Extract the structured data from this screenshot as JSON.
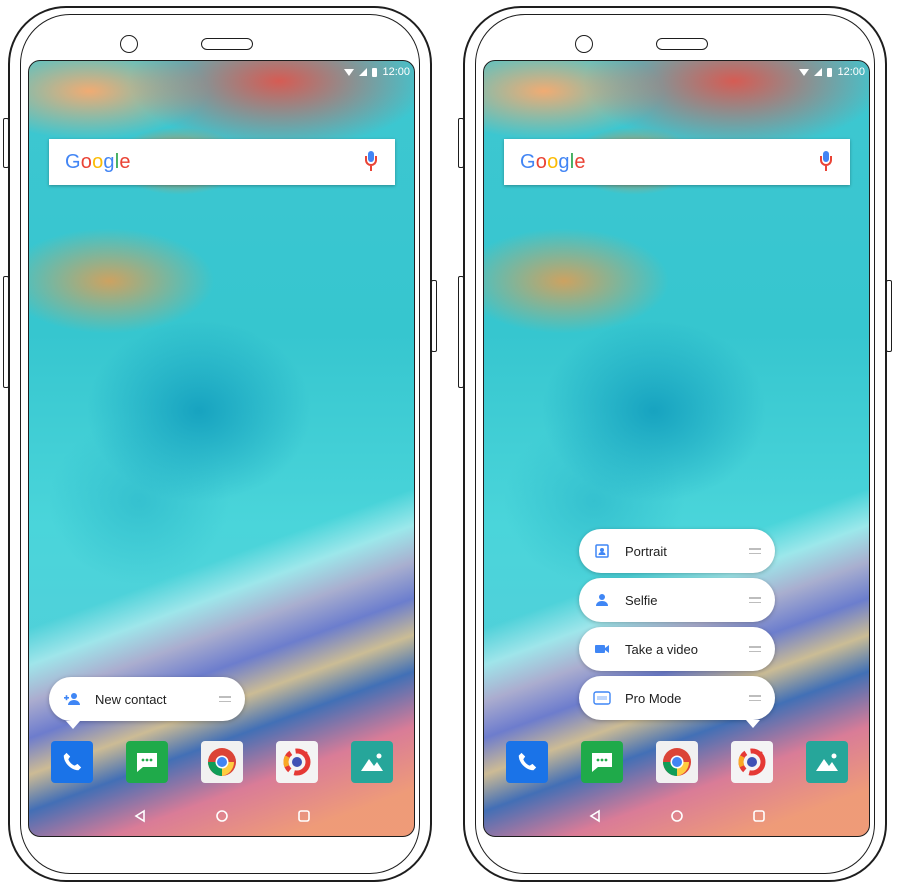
{
  "left_screen": {
    "status_bar": {
      "time": "12:00"
    },
    "search": {
      "logo": [
        "G",
        "o",
        "o",
        "g",
        "l",
        "e"
      ],
      "mic_icon": "mic-icon"
    },
    "shortcut_menu": {
      "items": [
        {
          "label": "New contact",
          "icon": "add-contact-icon"
        }
      ]
    },
    "dock": [
      "phone-icon",
      "messages-icon",
      "chrome-icon",
      "camera-icon",
      "gallery-icon"
    ]
  },
  "right_screen": {
    "status_bar": {
      "time": "12:00"
    },
    "search": {
      "logo": [
        "G",
        "o",
        "o",
        "g",
        "l",
        "e"
      ],
      "mic_icon": "mic-icon"
    },
    "shortcut_menu": {
      "items": [
        {
          "label": "Portrait",
          "icon": "portrait-icon"
        },
        {
          "label": "Selfie",
          "icon": "selfie-icon"
        },
        {
          "label": "Take a video",
          "icon": "video-icon"
        },
        {
          "label": "Pro Mode",
          "icon": "pro-mode-icon"
        }
      ]
    },
    "dock": [
      "phone-icon",
      "messages-icon",
      "chrome-icon",
      "camera-icon",
      "gallery-icon"
    ]
  },
  "colors": {
    "phone_blue": "#1a73e8",
    "messages_green": "#1faa4a",
    "gallery_teal": "#26a69a",
    "shortcut_icon_blue": "#3f86f5"
  }
}
